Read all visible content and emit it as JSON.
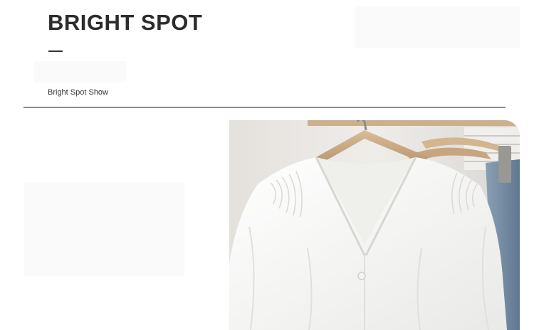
{
  "header": {
    "title": "BRIGHT SPOT",
    "subtitle": "Bright Spot Show"
  },
  "product_photo": {
    "subject": "white-v-neck-blouse-on-wooden-hanger"
  },
  "colors": {
    "title": "#2c2c2c",
    "rule": "#8f8f8f",
    "background": "#ffffff"
  }
}
